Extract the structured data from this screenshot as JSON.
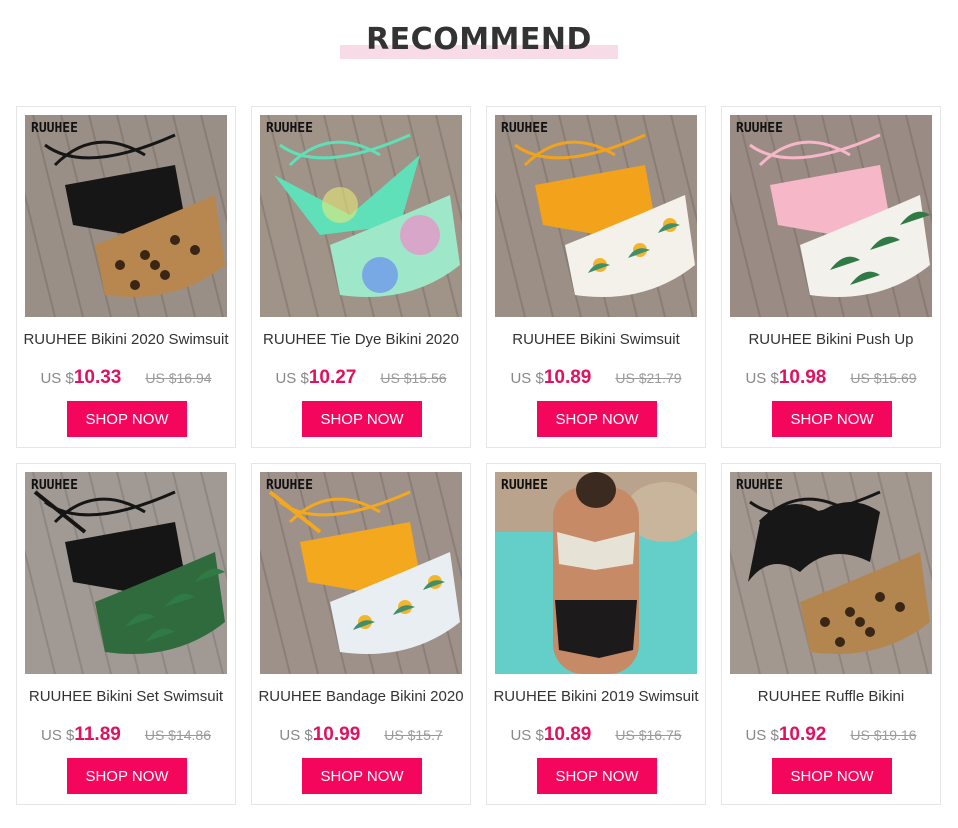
{
  "section": {
    "title": "RECOMMEND",
    "accent_color": "#f7dbe6"
  },
  "colors": {
    "price": "#e0115f",
    "button": "#f5065d",
    "button_text": "#ffffff"
  },
  "products": [
    {
      "brand": "RUUHEE",
      "title": "RUUHEE Bikini 2020 Swimsuit",
      "currency": "US $",
      "price": "10.33",
      "old_price": "US $16.94",
      "button": "SHOP NOW",
      "image": {
        "bg": "#9a8f86",
        "top": "#161616",
        "bottom": "#b8874f",
        "bottom_pattern": "leopard",
        "style": "strappy"
      }
    },
    {
      "brand": "RUUHEE",
      "title": "RUUHEE Tie Dye Bikini 2020",
      "currency": "US $",
      "price": "10.27",
      "old_price": "US $15.56",
      "button": "SHOP NOW",
      "image": {
        "bg": "#a09388",
        "top": "#5fe0b8",
        "bottom": "#9ee7c9",
        "bottom_pattern": "tiedye",
        "style": "triangle"
      }
    },
    {
      "brand": "RUUHEE",
      "title": "RUUHEE Bikini Swimsuit",
      "currency": "US $",
      "price": "10.89",
      "old_price": "US $21.79",
      "button": "SHOP NOW",
      "image": {
        "bg": "#9c8f86",
        "top": "#f2a31b",
        "bottom": "#f4f1ea",
        "bottom_pattern": "floral",
        "style": "bralette"
      }
    },
    {
      "brand": "RUUHEE",
      "title": "RUUHEE Bikini Push Up",
      "currency": "US $",
      "price": "10.98",
      "old_price": "US $15.69",
      "button": "SHOP NOW",
      "image": {
        "bg": "#9a8c84",
        "top": "#f6b7c9",
        "bottom": "#f3f1ec",
        "bottom_pattern": "palm",
        "style": "bralette"
      }
    },
    {
      "brand": "RUUHEE",
      "title": "RUUHEE Bikini Set Swimsuit",
      "currency": "US $",
      "price": "11.89",
      "old_price": "US $14.86",
      "button": "SHOP NOW",
      "image": {
        "bg": "#a19a94",
        "top": "#151515",
        "bottom": "#2f6b3c",
        "bottom_pattern": "palm",
        "style": "halter"
      }
    },
    {
      "brand": "RUUHEE",
      "title": "RUUHEE Bandage Bikini 2020",
      "currency": "US $",
      "price": "10.99",
      "old_price": "US $15.7",
      "button": "SHOP NOW",
      "image": {
        "bg": "#9e9189",
        "top": "#f4a81e",
        "bottom": "#e9eef2",
        "bottom_pattern": "floral",
        "style": "halter"
      }
    },
    {
      "brand": "RUUHEE",
      "title": "RUUHEE Bikini 2019 Swimsuit",
      "currency": "US $",
      "price": "10.89",
      "old_price": "US $16.75",
      "button": "SHOP NOW",
      "image": {
        "bg": "#5fc9c4",
        "top": "#e7e2d6",
        "bottom": "#1c1a1a",
        "bottom_pattern": "solid",
        "style": "model"
      }
    },
    {
      "brand": "RUUHEE",
      "title": "RUUHEE Ruffle Bikini",
      "currency": "US $",
      "price": "10.92",
      "old_price": "US $19.16",
      "button": "SHOP NOW",
      "image": {
        "bg": "#a39890",
        "top": "#171717",
        "bottom": "#b38650",
        "bottom_pattern": "leopard",
        "style": "ruffle"
      }
    }
  ]
}
